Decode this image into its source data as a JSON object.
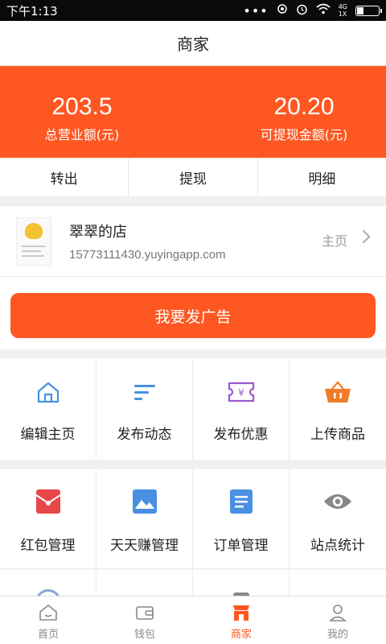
{
  "status_bar": {
    "time": "下午1:13",
    "dots": "•••",
    "network_top": "4G",
    "network_bottom": "1X"
  },
  "header": {
    "title": "商家"
  },
  "stats": {
    "total_revenue": {
      "value": "203.5",
      "label": "总营业额(元)"
    },
    "withdrawable": {
      "value": "20.20",
      "label": "可提现金额(元)"
    }
  },
  "actions": [
    {
      "label": "转出"
    },
    {
      "label": "提现"
    },
    {
      "label": "明细"
    }
  ],
  "store": {
    "name": "翠翠的店",
    "url": "15773111430.yuyingapp.com",
    "home_label": "主页"
  },
  "ad_button": {
    "label": "我要发广告"
  },
  "grid_row1": [
    {
      "label": "编辑主页",
      "icon": "home-outline-icon"
    },
    {
      "label": "发布动态",
      "icon": "lines-icon"
    },
    {
      "label": "发布优惠",
      "icon": "coupon-icon"
    },
    {
      "label": "上传商品",
      "icon": "basket-icon"
    }
  ],
  "grid_row2": [
    {
      "label": "红包管理",
      "icon": "red-envelope-icon"
    },
    {
      "label": "天天赚管理",
      "icon": "image-icon"
    },
    {
      "label": "订单管理",
      "icon": "document-icon"
    },
    {
      "label": "站点统计",
      "icon": "eye-icon"
    }
  ],
  "tabs": [
    {
      "label": "首页",
      "icon": "home-icon"
    },
    {
      "label": "钱包",
      "icon": "wallet-icon"
    },
    {
      "label": "商家",
      "icon": "shop-icon",
      "active": true
    },
    {
      "label": "我的",
      "icon": "user-icon"
    }
  ],
  "colors": {
    "accent": "#fe5722",
    "blue": "#4a90e2",
    "purple": "#9b59d0",
    "red": "#e8474a",
    "gray": "#888888"
  }
}
